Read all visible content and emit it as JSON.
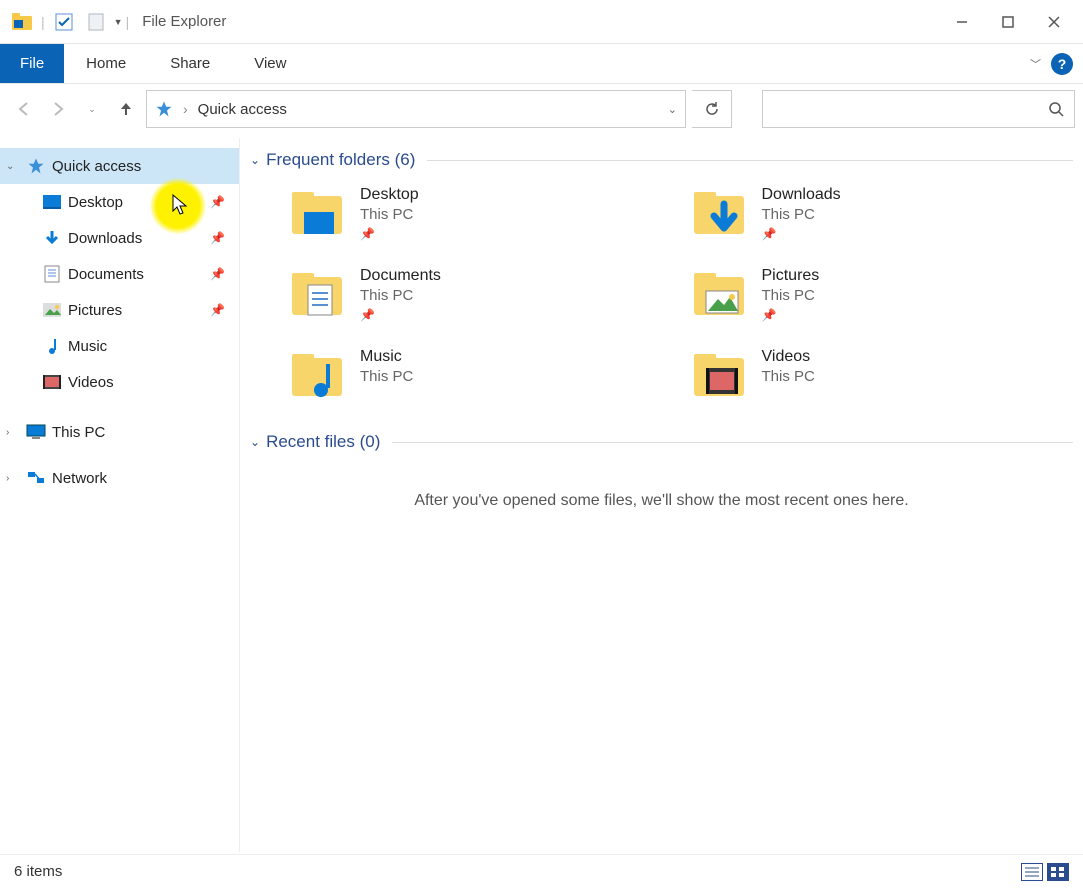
{
  "window": {
    "title": "File Explorer"
  },
  "ribbon": {
    "file": "File",
    "tabs": [
      "Home",
      "Share",
      "View"
    ]
  },
  "nav": {
    "address_location": "Quick access"
  },
  "sidebar": {
    "quick_access": {
      "label": "Quick access",
      "children": [
        {
          "label": "Desktop",
          "pinned": true
        },
        {
          "label": "Downloads",
          "pinned": true
        },
        {
          "label": "Documents",
          "pinned": true
        },
        {
          "label": "Pictures",
          "pinned": true
        },
        {
          "label": "Music",
          "pinned": false
        },
        {
          "label": "Videos",
          "pinned": false
        }
      ]
    },
    "this_pc": {
      "label": "This PC"
    },
    "network": {
      "label": "Network"
    }
  },
  "content": {
    "frequent": {
      "heading": "Frequent folders (6)",
      "items": [
        {
          "name": "Desktop",
          "sub": "This PC",
          "pinned": true
        },
        {
          "name": "Downloads",
          "sub": "This PC",
          "pinned": true
        },
        {
          "name": "Documents",
          "sub": "This PC",
          "pinned": true
        },
        {
          "name": "Pictures",
          "sub": "This PC",
          "pinned": true
        },
        {
          "name": "Music",
          "sub": "This PC",
          "pinned": false
        },
        {
          "name": "Videos",
          "sub": "This PC",
          "pinned": false
        }
      ]
    },
    "recent": {
      "heading": "Recent files (0)",
      "empty_message": "After you've opened some files, we'll show the most recent ones here."
    }
  },
  "status": {
    "item_count_text": "6 items"
  }
}
